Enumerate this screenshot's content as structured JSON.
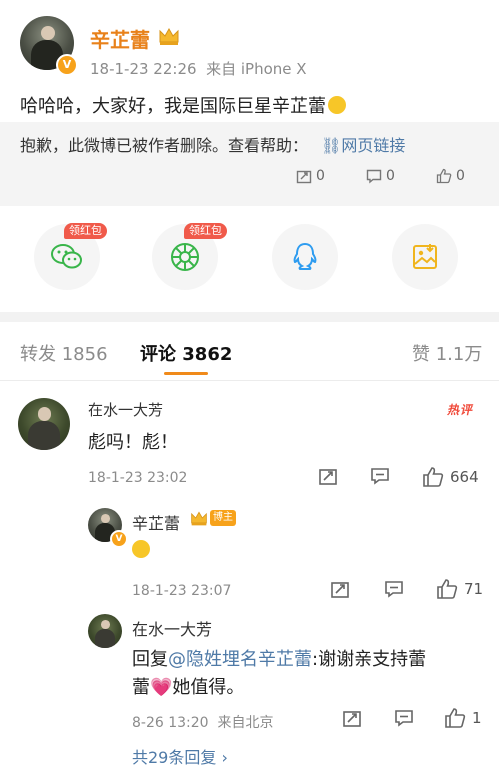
{
  "post": {
    "author": "辛芷蕾",
    "date": "18-1-23 22:26",
    "source": "来自 iPhone X",
    "text": "哈哈哈，大家好，我是国际巨星辛芷蕾",
    "notice": "抱歉，此微博已被作者删除。查看帮助：",
    "notice_link": "网页链接",
    "reposts_count": "0",
    "comments_count": "0",
    "likes_count": "0"
  },
  "share": {
    "hongbao_tag": "领红包"
  },
  "tabs": {
    "repost": "转发 1856",
    "comment": "评论 3862",
    "like": "赞 1.1万"
  },
  "comments": [
    {
      "name": "在水一大芳",
      "text": "彪吗！彪！",
      "date": "18-1-23 23:02",
      "likes": "664",
      "badge": "热评"
    }
  ],
  "reply1": {
    "name": "辛芷蕾",
    "badge": "博主",
    "date": "18-1-23 23:07",
    "likes": "71"
  },
  "reply2": {
    "name": "在水一大芳",
    "prefix": "回复",
    "mention": "@隐姓埋名辛芷蕾",
    "text_a": ":谢谢亲支持蕾",
    "text_b": "蕾",
    "text_c": "她值得。",
    "date": "8-26 13:20",
    "location": "来自北京",
    "likes": "1"
  },
  "more_replies": "共29条回复 ›",
  "colors": {
    "accent": "#e8811a",
    "link": "#4f7aa7",
    "hot": "#f04a3a"
  }
}
